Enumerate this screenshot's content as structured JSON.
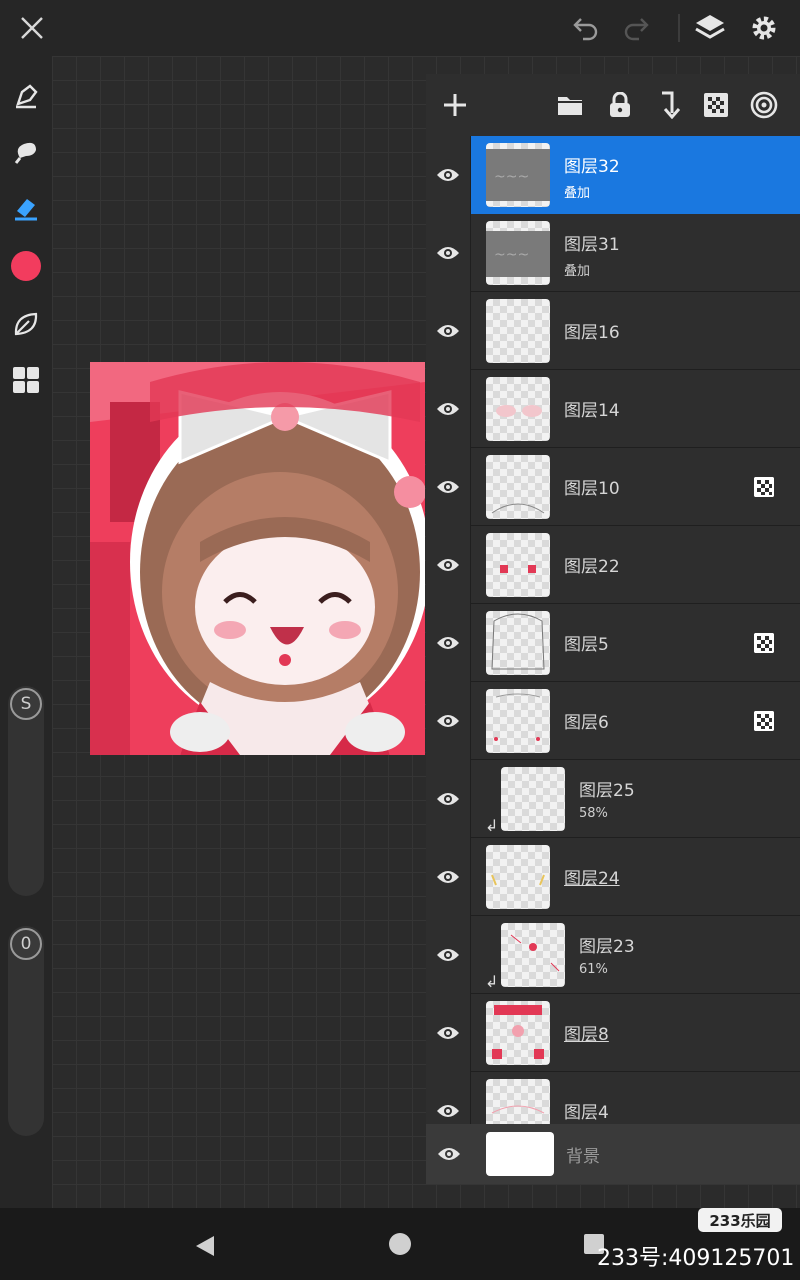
{
  "colors": {
    "accent": "#1a78e0",
    "brush": "#f23c5e",
    "eraser": "#3aa3ff",
    "background": "#262626",
    "panel": "#2e2e2e"
  },
  "topbar": {
    "icons": [
      "close-icon",
      "undo-icon",
      "redo-icon",
      "layers-icon",
      "gear-icon"
    ]
  },
  "toolbar": {
    "tools": [
      "pen-icon",
      "smudge-icon",
      "eraser-icon",
      "color-swatch",
      "leaf-icon",
      "grid-menu-icon"
    ],
    "size_slider_label": "S",
    "opacity_slider_label": "0"
  },
  "layer_panel": {
    "toolbar_icons": [
      "add-icon",
      "folder-icon",
      "lock-icon",
      "merge-down-icon",
      "checker-icon",
      "target-icon"
    ],
    "layers": [
      {
        "name": "图层32",
        "sub": "叠加",
        "selected": true,
        "clip": false,
        "alpha_lock": false,
        "underline": false
      },
      {
        "name": "图层31",
        "sub": "叠加",
        "selected": false,
        "clip": false,
        "alpha_lock": false,
        "underline": false
      },
      {
        "name": "图层16",
        "sub": "",
        "selected": false,
        "clip": false,
        "alpha_lock": false,
        "underline": false
      },
      {
        "name": "图层14",
        "sub": "",
        "selected": false,
        "clip": false,
        "alpha_lock": false,
        "underline": false
      },
      {
        "name": "图层10",
        "sub": "",
        "selected": false,
        "clip": false,
        "alpha_lock": true,
        "underline": false
      },
      {
        "name": "图层22",
        "sub": "",
        "selected": false,
        "clip": false,
        "alpha_lock": false,
        "underline": false
      },
      {
        "name": "图层5",
        "sub": "",
        "selected": false,
        "clip": false,
        "alpha_lock": true,
        "underline": false
      },
      {
        "name": "图层6",
        "sub": "",
        "selected": false,
        "clip": false,
        "alpha_lock": true,
        "underline": false
      },
      {
        "name": "图层25",
        "sub": "58%",
        "selected": false,
        "clip": true,
        "alpha_lock": false,
        "underline": false
      },
      {
        "name": "图层24",
        "sub": "",
        "selected": false,
        "clip": false,
        "alpha_lock": false,
        "underline": true
      },
      {
        "name": "图层23",
        "sub": "61%",
        "selected": false,
        "clip": true,
        "alpha_lock": false,
        "underline": false
      },
      {
        "name": "图层8",
        "sub": "",
        "selected": false,
        "clip": false,
        "alpha_lock": false,
        "underline": true
      },
      {
        "name": "图层4",
        "sub": "",
        "selected": false,
        "clip": false,
        "alpha_lock": false,
        "underline": false
      }
    ],
    "background_layer": {
      "name": "背景"
    }
  },
  "watermark": {
    "logo": "233乐园",
    "id_text": "233号:409125701"
  }
}
